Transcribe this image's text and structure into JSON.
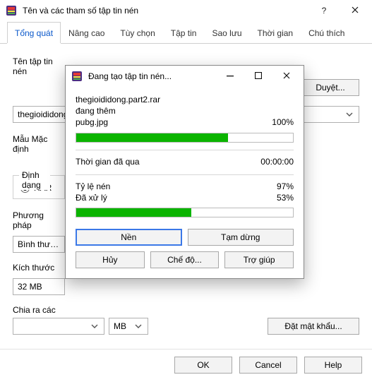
{
  "parent": {
    "title": "Tên và các tham số tập tin nén",
    "tabs": [
      "Tổng quát",
      "Nâng cao",
      "Tùy chọn",
      "Tập tin",
      "Sao lưu",
      "Thời gian",
      "Chú thích"
    ],
    "active_tab_index": 0,
    "labels": {
      "archive_name": "Tên tập tin nén",
      "browse": "Duyệt...",
      "default_profile": "Mẫu Mặc định",
      "archive_format": "Định dạng",
      "compression_method": "Phương pháp",
      "volume_size": "Kích thước",
      "split": "Chia ra các",
      "set_password": "Đặt mật khẩu..."
    },
    "values": {
      "archive_name": "thegioididong",
      "format_selected": "RAR",
      "method": "Bình thường",
      "volume_size": "32 MB",
      "split_unit": "MB"
    },
    "footer": {
      "ok": "OK",
      "cancel": "Cancel",
      "help": "Help"
    }
  },
  "modal": {
    "title": "Đang tạo tập tin nén...",
    "file_line": "thegioididong.part2.rar",
    "action_line": "đang thêm",
    "current_file": "pubg.jpg",
    "current_pct_label": "100%",
    "current_pct": 70,
    "sections": {
      "elapsed_label": "Thời gian đã qua",
      "elapsed_value": "00:00:00",
      "ratio_label": "Tỷ lệ nén",
      "ratio_value": "97%",
      "processed_label": "Đã xử lý",
      "processed_value": "53%",
      "processed_pct": 53
    },
    "buttons": {
      "background": "Nền",
      "pause": "Tạm dừng",
      "cancel": "Hủy",
      "mode": "Chế độ...",
      "help": "Trợ giúp"
    }
  },
  "icons": {
    "app": "rar-icon",
    "minimize": "minimize-icon",
    "maximize": "maximize-icon",
    "close": "close-icon",
    "chevron_down": "chevron-down-icon"
  }
}
